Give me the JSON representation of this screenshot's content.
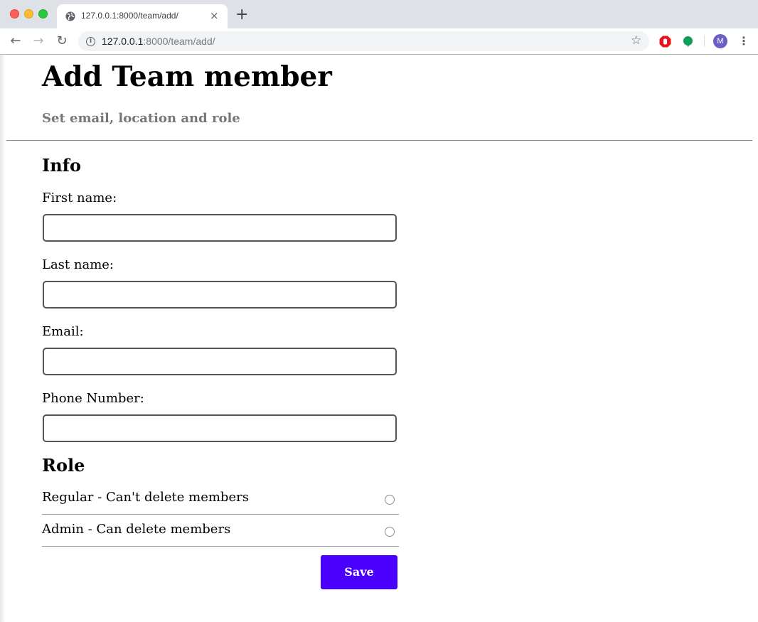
{
  "browser": {
    "tab_title": "127.0.0.1:8000/team/add/",
    "tab_close": "×",
    "new_tab": "+",
    "url_host": "127.0.0.1",
    "url_rest": ":8000/team/add/",
    "back": "←",
    "forward": "→",
    "reload": "↻",
    "info": "i",
    "star": "☆",
    "avatar_letter": "M",
    "menu": "⋮",
    "colors": {
      "tabbar": "#dee1e6",
      "ext_red": "#e8141c",
      "ext_green": "#0f9d58",
      "avatar": "#6b5fc7"
    }
  },
  "header": {
    "title": "Add Team member",
    "subtitle": "Set email, location and role"
  },
  "form": {
    "info_title": "Info",
    "fields": {
      "first_name": {
        "label": "First name:",
        "value": ""
      },
      "last_name": {
        "label": "Last name:",
        "value": ""
      },
      "email": {
        "label": "Email:",
        "value": ""
      },
      "phone": {
        "label": "Phone Number:",
        "value": ""
      }
    },
    "role_title": "Role",
    "roles": [
      {
        "label": "Regular - Can't delete members",
        "selected": false
      },
      {
        "label": "Admin - Can delete members",
        "selected": false
      }
    ],
    "save_label": "Save",
    "colors": {
      "save_button": "#4a00ff"
    }
  }
}
